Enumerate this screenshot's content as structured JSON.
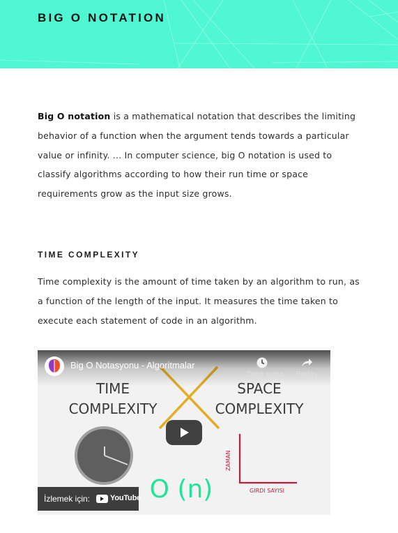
{
  "header": {
    "title": "BIG O NOTATION"
  },
  "intro": {
    "term": "Big O notation",
    "text": " is a mathematical notation that describes the limiting behavior of a function when the argument tends towards a particular value or infinity. ... In computer science, big O notation is used to classify algorithms according to how their run time or space requirements grow as the input size grows."
  },
  "time_complexity": {
    "heading": "TIME COMPLEXITY",
    "text": "Time complexity is the amount of time taken by an algorithm to run, as a function of the length of the input. It measures the time taken to execute each statement of code in an algorithm."
  },
  "video": {
    "title": "Big O Notasyonu - Algoritmalar",
    "watch_later_label": "Daha sonra...",
    "share_label": "Paylaş",
    "watch_on_label": "İzlemek için:",
    "youtube_label": "YouTube",
    "thumbnail": {
      "time_line_1": "TIME",
      "time_line_2": "COMPLEXITY",
      "space_line_1": "SPACE",
      "space_line_2": "COMPLEXITY",
      "big_o": "O (n)",
      "y_axis_label": "ZAMAN",
      "x_axis_label": "GIRDI SAYISI"
    }
  },
  "colors": {
    "hero": "#4ff7d3",
    "play_button": "#232323",
    "thumbnail_cross": "#e3ac24",
    "thumbnail_axis": "#c31d39",
    "big_o_text": "#20e49a"
  },
  "icons": {
    "watch_later": "clock-icon",
    "share": "share-arrow-icon",
    "play": "play-icon",
    "youtube": "youtube-logo"
  }
}
